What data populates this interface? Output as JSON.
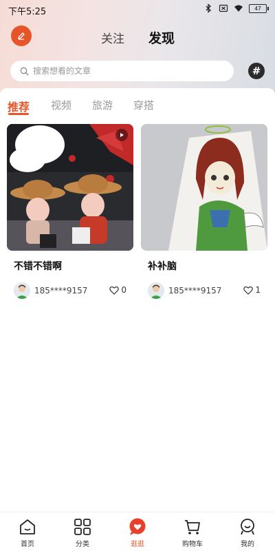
{
  "status_bar": {
    "time": "下午5:25",
    "battery": "47"
  },
  "header": {
    "tabs": [
      {
        "label": "关注",
        "active": false
      },
      {
        "label": "发现",
        "active": true
      }
    ],
    "search_placeholder": "搜索想看的文章",
    "hash_symbol": "#"
  },
  "category_tabs": [
    {
      "label": "推荐",
      "active": true
    },
    {
      "label": "视频",
      "active": false
    },
    {
      "label": "旅游",
      "active": false
    },
    {
      "label": "穿搭",
      "active": false
    }
  ],
  "posts": [
    {
      "title": "不错不错啊",
      "username": "185****9157",
      "likes": "0",
      "is_video": true
    },
    {
      "title": "补补脑",
      "username": "185****9157",
      "likes": "1",
      "is_video": false
    }
  ],
  "bottom_nav": [
    {
      "label": "首页",
      "icon": "home-icon",
      "active": false
    },
    {
      "label": "分类",
      "icon": "grid-icon",
      "active": false
    },
    {
      "label": "逛逛",
      "icon": "heart-bubble-icon",
      "active": true
    },
    {
      "label": "购物车",
      "icon": "cart-icon",
      "active": false
    },
    {
      "label": "我的",
      "icon": "profile-icon",
      "active": false
    }
  ],
  "colors": {
    "accent": "#e8542a",
    "dark": "#2b2b2b"
  }
}
